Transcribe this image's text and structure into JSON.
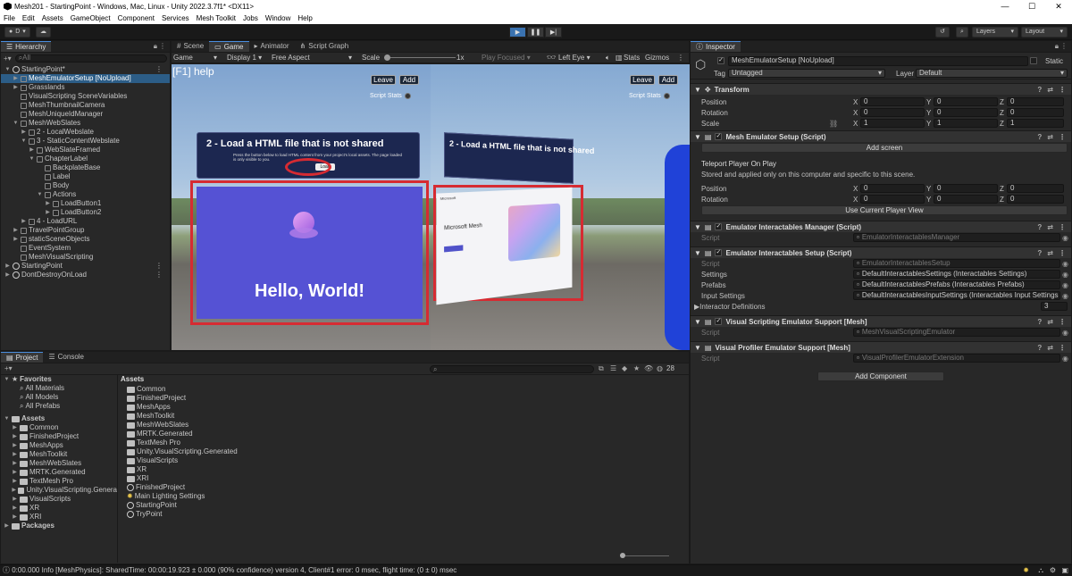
{
  "window": {
    "title": "Mesh201 - StartingPoint - Windows, Mac, Linux - Unity 2022.3.7f1* <DX11>"
  },
  "menu": [
    "File",
    "Edit",
    "Assets",
    "GameObject",
    "Component",
    "Services",
    "Mesh Toolkit",
    "Jobs",
    "Window",
    "Help"
  ],
  "toolbar": {
    "account": "D",
    "layers": "Layers",
    "layout": "Layout"
  },
  "hierarchy": {
    "tab": "Hierarchy",
    "search_placeholder": "All",
    "items": [
      {
        "label": "StartingPoint*",
        "depth": 0,
        "icon": "unity",
        "arrow": "▼"
      },
      {
        "label": "MeshEmulatorSetup [NoUpload]",
        "depth": 1,
        "icon": "cube",
        "arrow": "▶",
        "selected": true
      },
      {
        "label": "Grasslands",
        "depth": 1,
        "icon": "cube",
        "arrow": "▶"
      },
      {
        "label": "VisualScripting SceneVariables",
        "depth": 1,
        "icon": "cube",
        "arrow": ""
      },
      {
        "label": "MeshThumbnailCamera",
        "depth": 1,
        "icon": "cube",
        "arrow": ""
      },
      {
        "label": "MeshUniqueIdManager",
        "depth": 1,
        "icon": "cube",
        "arrow": ""
      },
      {
        "label": "MeshWebSlates",
        "depth": 1,
        "icon": "cube",
        "arrow": "▼"
      },
      {
        "label": "2 - LocalWebslate",
        "depth": 2,
        "icon": "cube",
        "arrow": "▶"
      },
      {
        "label": "3 - StaticContentWebslate",
        "depth": 2,
        "icon": "cube",
        "arrow": "▼"
      },
      {
        "label": "WebSlateFramed",
        "depth": 3,
        "icon": "cube",
        "arrow": "▶"
      },
      {
        "label": "ChapterLabel",
        "depth": 3,
        "icon": "cube",
        "arrow": "▼"
      },
      {
        "label": "BackplateBase",
        "depth": 4,
        "icon": "cube",
        "arrow": ""
      },
      {
        "label": "Label",
        "depth": 4,
        "icon": "cube",
        "arrow": ""
      },
      {
        "label": "Body",
        "depth": 4,
        "icon": "cube",
        "arrow": ""
      },
      {
        "label": "Actions",
        "depth": 4,
        "icon": "cube",
        "arrow": "▼"
      },
      {
        "label": "LoadButton1",
        "depth": 5,
        "icon": "cube",
        "arrow": "▶"
      },
      {
        "label": "LoadButton2",
        "depth": 5,
        "icon": "cube",
        "arrow": "▶"
      },
      {
        "label": "4 - LoadURL",
        "depth": 2,
        "icon": "cube",
        "arrow": "▶"
      },
      {
        "label": "TravelPointGroup",
        "depth": 1,
        "icon": "cube",
        "arrow": "▶"
      },
      {
        "label": "staticSceneObjects",
        "depth": 1,
        "icon": "cube",
        "arrow": "▶"
      },
      {
        "label": "EventSystem",
        "depth": 1,
        "icon": "cube",
        "arrow": ""
      },
      {
        "label": "MeshVisualScripting",
        "depth": 1,
        "icon": "cube",
        "arrow": ""
      },
      {
        "label": "StartingPoint",
        "depth": 0,
        "icon": "unity",
        "arrow": "▶"
      },
      {
        "label": "DontDestroyOnLoad",
        "depth": 0,
        "icon": "unity",
        "arrow": "▶"
      }
    ]
  },
  "scene_tabs": [
    "Scene",
    "Game",
    "Animator",
    "Script Graph"
  ],
  "game_toolbar": {
    "mode": "Game",
    "display": "Display 1",
    "aspect": "Free Aspect",
    "scale_label": "Scale",
    "scale_value": "1x",
    "play_focused": "Play Focused",
    "eye": "Left Eye",
    "stats": "Stats",
    "gizmos": "Gizmos"
  },
  "game_view": {
    "help": "[F1] help",
    "leave": "Leave",
    "add": "Add",
    "script_stats": "Script Stats",
    "slate_title": "2 - Load a HTML file that is not shared",
    "slate_body": "Press the button below to load HTML content from your project's local assets. The page loaded is only visible to you.",
    "load_button": "Load",
    "hello": "Hello, World!",
    "slate_title_right": "2 - Load a HTML file that is not shared",
    "ms_mesh": "Microsoft Mesh",
    "ms_logo": "Microsoft"
  },
  "project": {
    "tabs": [
      "Project",
      "Console"
    ],
    "favorites_label": "Favorites",
    "favorites": [
      "All Materials",
      "All Models",
      "All Prefabs"
    ],
    "assets_label": "Assets",
    "asset_tree": [
      "Common",
      "FinishedProject",
      "MeshApps",
      "MeshToolkit",
      "MeshWebSlates",
      "MRTK.Generated",
      "TextMesh Pro",
      "Unity.VisualScripting.Genera",
      "VisualScripts",
      "XR",
      "XRI"
    ],
    "packages_label": "Packages",
    "breadcrumb": "Assets",
    "hidden_count": "28",
    "asset_list": [
      {
        "label": "Common",
        "icon": "folder"
      },
      {
        "label": "FinishedProject",
        "icon": "folder"
      },
      {
        "label": "MeshApps",
        "icon": "folder"
      },
      {
        "label": "MeshToolkit",
        "icon": "folder"
      },
      {
        "label": "MeshWebSlates",
        "icon": "folder"
      },
      {
        "label": "MRTK.Generated",
        "icon": "folder"
      },
      {
        "label": "TextMesh Pro",
        "icon": "folder"
      },
      {
        "label": "Unity.VisualScripting.Generated",
        "icon": "folder"
      },
      {
        "label": "VisualScripts",
        "icon": "folder"
      },
      {
        "label": "XR",
        "icon": "folder"
      },
      {
        "label": "XRI",
        "icon": "folder"
      },
      {
        "label": "FinishedProject",
        "icon": "unity"
      },
      {
        "label": "Main Lighting Settings",
        "icon": "light"
      },
      {
        "label": "StartingPoint",
        "icon": "unity"
      },
      {
        "label": "TryPoint",
        "icon": "unity"
      }
    ]
  },
  "inspector": {
    "tab": "Inspector",
    "object_name": "MeshEmulatorSetup [NoUpload]",
    "static": "Static",
    "tag_label": "Tag",
    "tag_value": "Untagged",
    "layer_label": "Layer",
    "layer_value": "Default",
    "transform": {
      "title": "Transform",
      "rows": [
        {
          "label": "Position",
          "x": "0",
          "y": "0",
          "z": "0"
        },
        {
          "label": "Rotation",
          "x": "0",
          "y": "0",
          "z": "0"
        },
        {
          "label": "Scale",
          "x": "1",
          "y": "1",
          "z": "1"
        }
      ]
    },
    "mesh_emulator": {
      "title": "Mesh Emulator Setup (Script)",
      "add_screen": "Add screen",
      "teleport_label": "Teleport Player On Play",
      "teleport_desc": "Stored and applied only on this computer and specific to this scene.",
      "rows": [
        {
          "label": "Position",
          "x": "0",
          "y": "0",
          "z": "0"
        },
        {
          "label": "Rotation",
          "x": "0",
          "y": "0",
          "z": "0"
        }
      ],
      "use_current": "Use Current Player View"
    },
    "interactables_manager": {
      "title": "Emulator Interactables Manager (Script)",
      "script_label": "Script",
      "script_value": "EmulatorInteractablesManager"
    },
    "interactables_setup": {
      "title": "Emulator Interactables Setup (Script)",
      "rows": [
        {
          "label": "Script",
          "value": "EmulatorInteractablesSetup"
        },
        {
          "label": "Settings",
          "value": "DefaultInteractablesSettings (Interactables Settings)"
        },
        {
          "label": "Prefabs",
          "value": "DefaultInteractablesPrefabs (Interactables Prefabs)"
        },
        {
          "label": "Input Settings",
          "value": "DefaultInteractablesInputSettings (Interactables Input Settings"
        }
      ],
      "interactor_label": "Interactor Definitions",
      "interactor_count": "3"
    },
    "visual_scripting": {
      "title": "Visual Scripting Emulator Support [Mesh]",
      "script_label": "Script",
      "script_value": "MeshVisualScriptingEmulator"
    },
    "visual_profiler": {
      "title": "Visual Profiler Emulator Support [Mesh]",
      "script_label": "Script",
      "script_value": "VisualProfilerEmulatorExtension"
    },
    "add_component": "Add Component"
  },
  "status": {
    "text": "0:00.000 Info [MeshPhysics]: SharedTime: 00:00:19.923 ± 0.000 (90% confidence) version 4, Client#1 error: 0 msec, flight time: (0 ± 0) msec"
  }
}
